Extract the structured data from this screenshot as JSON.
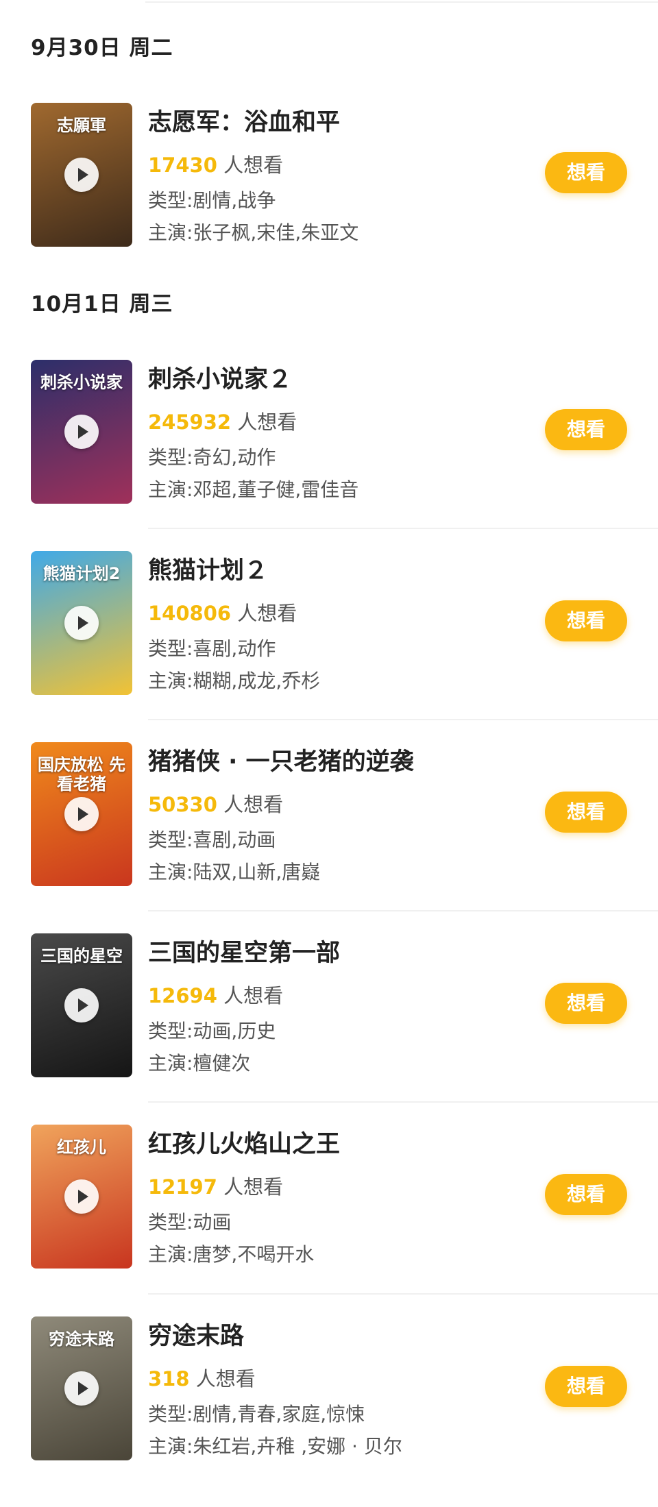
{
  "movies": [
    {
      "date": "9月30日 周二",
      "title": "志愿军：浴血和平",
      "want_count": "17430",
      "want_suffix": " 人想看",
      "genre": "类型:剧情,战争",
      "cast": "主演:张子枫,宋佳,朱亚文",
      "poster_text": "志願軍",
      "poster_colors": [
        "#a0692f",
        "#3d2a1a"
      ],
      "button": "想看"
    },
    {
      "date": "10月1日 周三",
      "title": "刺杀小说家２",
      "want_count": "245932",
      "want_suffix": " 人想看",
      "genre": "类型:奇幻,动作",
      "cast": "主演:邓超,董子健,雷佳音",
      "poster_text": "刺杀小说家",
      "poster_colors": [
        "#2c2f6a",
        "#a0305a"
      ],
      "button": "想看"
    },
    {
      "date": "",
      "title": "熊猫计划２",
      "want_count": "140806",
      "want_suffix": " 人想看",
      "genre": "类型:喜剧,动作",
      "cast": "主演:糊糊,成龙,乔杉",
      "poster_text": "熊猫计划2",
      "poster_colors": [
        "#3fa9e8",
        "#f2c234"
      ],
      "button": "想看"
    },
    {
      "date": "",
      "title": "猪猪侠 · 一只老猪的逆袭",
      "want_count": "50330",
      "want_suffix": " 人想看",
      "genre": "类型:喜剧,动画",
      "cast": "主演:陆双,山新,唐嶷",
      "poster_text": "国庆放松 先看老猪",
      "poster_colors": [
        "#f08a1c",
        "#c9361e"
      ],
      "button": "想看"
    },
    {
      "date": "",
      "title": "三国的星空第一部",
      "want_count": "12694",
      "want_suffix": " 人想看",
      "genre": "类型:动画,历史",
      "cast": "主演:檀健次",
      "poster_text": "三国的星空",
      "poster_colors": [
        "#4a4a4a",
        "#151515"
      ],
      "button": "想看"
    },
    {
      "date": "",
      "title": "红孩儿火焰山之王",
      "want_count": "12197",
      "want_suffix": " 人想看",
      "genre": "类型:动画",
      "cast": "主演:唐梦,不喝开水",
      "poster_text": "红孩儿",
      "poster_colors": [
        "#f0a45c",
        "#c8351f"
      ],
      "button": "想看"
    },
    {
      "date": "",
      "title": "穷途末路",
      "want_count": "318",
      "want_suffix": " 人想看",
      "genre": "类型:剧情,青春,家庭,惊悚",
      "cast": "主演:朱红岩,卉稚 ,安娜 · 贝尔",
      "poster_text": "穷途末路",
      "poster_colors": [
        "#8f8a7a",
        "#4a4538"
      ],
      "button": "想看"
    }
  ]
}
